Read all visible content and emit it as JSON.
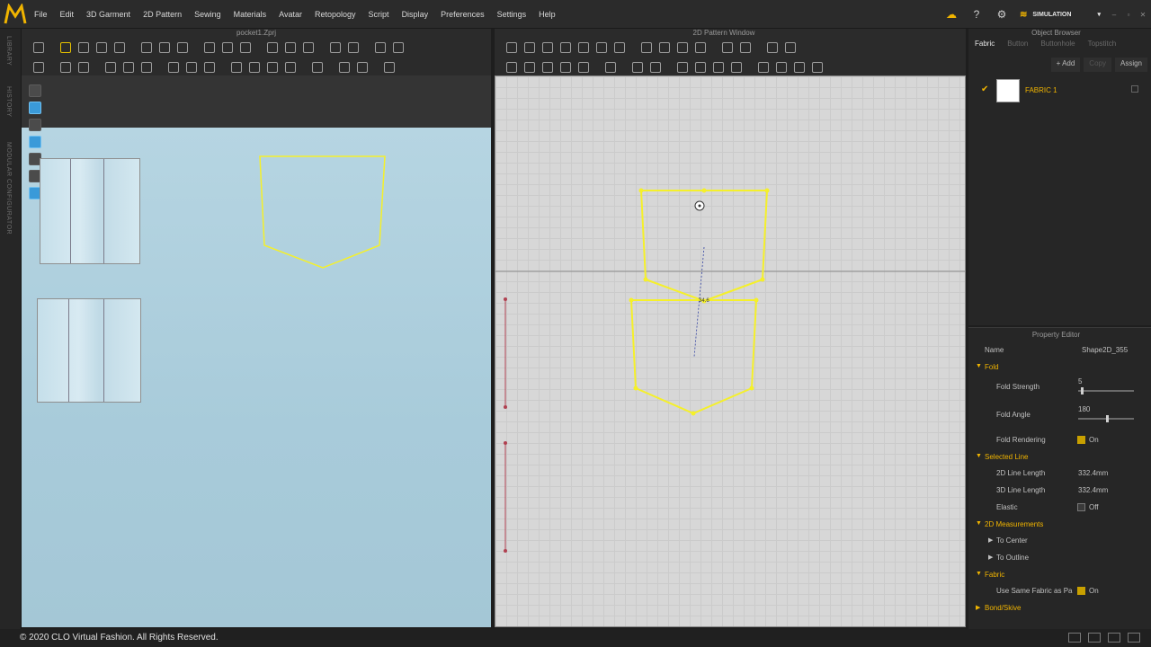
{
  "menubar": {
    "items": [
      "File",
      "Edit",
      "3D Garment",
      "2D Pattern",
      "Sewing",
      "Materials",
      "Avatar",
      "Retopology",
      "Script",
      "Display",
      "Preferences",
      "Settings",
      "Help"
    ],
    "mode_label": "SIMULATION"
  },
  "left_strip": {
    "labels": [
      "LIBRARY",
      "HISTORY",
      "MODULAR CONFIGURATOR"
    ]
  },
  "view3d": {
    "title": "pocket1.Zprj"
  },
  "view2d": {
    "title": "2D Pattern Window",
    "measure_label": "34.6"
  },
  "object_browser": {
    "title": "Object Browser",
    "tabs": [
      "Fabric",
      "Button",
      "Buttonhole",
      "Topstitch"
    ],
    "actions": {
      "add": "+ Add",
      "copy": "Copy",
      "assign": "Assign"
    },
    "fabric": {
      "name": "FABRIC 1"
    }
  },
  "property_editor": {
    "title": "Property Editor",
    "name_label": "Name",
    "name_value": "Shape2D_355",
    "fold": {
      "section": "Fold",
      "strength_label": "Fold Strength",
      "strength_value": "5",
      "strength_fraction": 0.05,
      "angle_label": "Fold Angle",
      "angle_value": "180",
      "angle_fraction": 0.5,
      "rendering_label": "Fold Rendering",
      "rendering_value": "On"
    },
    "selected_line": {
      "section": "Selected Line",
      "length2d_label": "2D Line Length",
      "length2d_value": "332.4mm",
      "length3d_label": "3D Line Length",
      "length3d_value": "332.4mm",
      "elastic_label": "Elastic",
      "elastic_value": "Off"
    },
    "measurements": {
      "section": "2D Measurements",
      "to_center": "To Center",
      "to_outline": "To Outline"
    },
    "fabric": {
      "section": "Fabric",
      "same_label": "Use Same Fabric as Pa",
      "same_value": "On"
    },
    "bond": {
      "section": "Bond/Skive"
    }
  },
  "status": {
    "copyright": "© 2020 CLO Virtual Fashion. All Rights Reserved."
  },
  "colors": {
    "accent": "#f0b400",
    "selection": "#f5f02a",
    "bg": "#262626"
  }
}
